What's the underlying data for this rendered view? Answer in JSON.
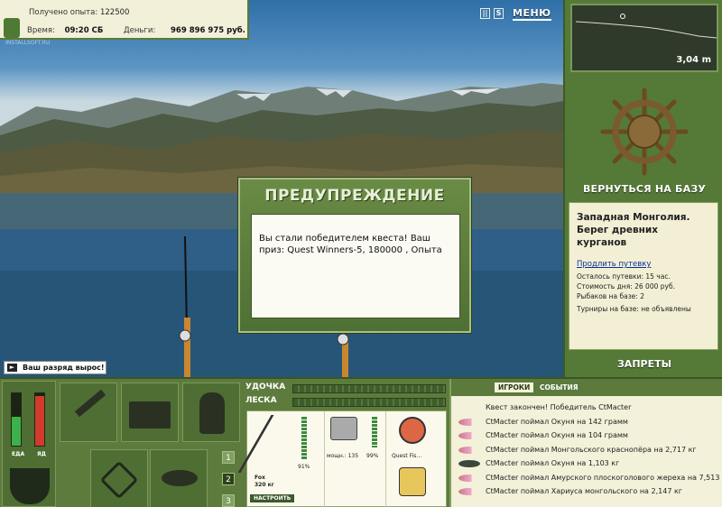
{
  "stats": {
    "experience_label": "Получено опыта:",
    "experience_value": "122500",
    "time_label": "Время:",
    "time_value": "09:20 СБ",
    "money_label": "Деньги:",
    "money_value": "969 896 975 руб.",
    "watermark": "INSTALLSOFT.RU"
  },
  "topbar": {
    "pause_icon": "pause-icon",
    "sound_icon": "sound-icon",
    "sound_label": "S",
    "menu_label": "МЕНЮ"
  },
  "depth": {
    "value": "3,04 m"
  },
  "base": {
    "return_label": "ВЕРНУТЬСЯ НА БАЗУ",
    "location_title": "Западная Монголия. Берег древних курганов",
    "extend_link": "Продлить путевку",
    "trip_left": "Осталось путевки: 15 час.",
    "day_cost": "Стоимость дня: 26 000 руб.",
    "anglers": "Рыбаков на базе: 2",
    "tournaments": "Турниры на базе: не объявлены",
    "bans_label": "ЗАПРЕТЫ"
  },
  "dialog": {
    "title": "ПРЕДУПРЕЖДЕНИЕ",
    "message": "Вы стали победителем квеста! Ваш приз: Quest Winners-5, 180000 , Опыта"
  },
  "rankup": {
    "label": "Ваш разряд вырос!"
  },
  "bottom": {
    "food_label": "ЕДА",
    "poison_label": "ЯД",
    "food_level": 0.55,
    "poison_level": 0.95,
    "rod_label": "УДОЧКА",
    "line_label": "ЛЕСКА",
    "page_numbers": [
      "1",
      "2",
      "3"
    ],
    "tackle": {
      "rod_pct": "91%",
      "rod_name": "Fox",
      "rod_weight": "320 кг",
      "setup_button": "НАСТРОИТЬ",
      "reel_power": "мощн.: 135",
      "reel_pct": "99%",
      "line_name": "Quest Fis..."
    }
  },
  "events": {
    "tabs": [
      "ИГРОКИ",
      "СОБЫТИЯ"
    ],
    "lines": [
      "Квест закончен! Победитель CtMacter",
      "CtMacter поймал Окуня на 142 грамм",
      "CtMacter поймал Окуня на 104 грамм",
      "CtMacter поймал Монгольского краснопёра на 2,717 кг",
      "CtMacter поймал Окуня на 1,103 кг",
      "CtMacter поймал Амурского плоскоголового жереха на 7,513 кг",
      "CtMacter поймал Хариуса монгольского на 2,147 кг"
    ]
  }
}
